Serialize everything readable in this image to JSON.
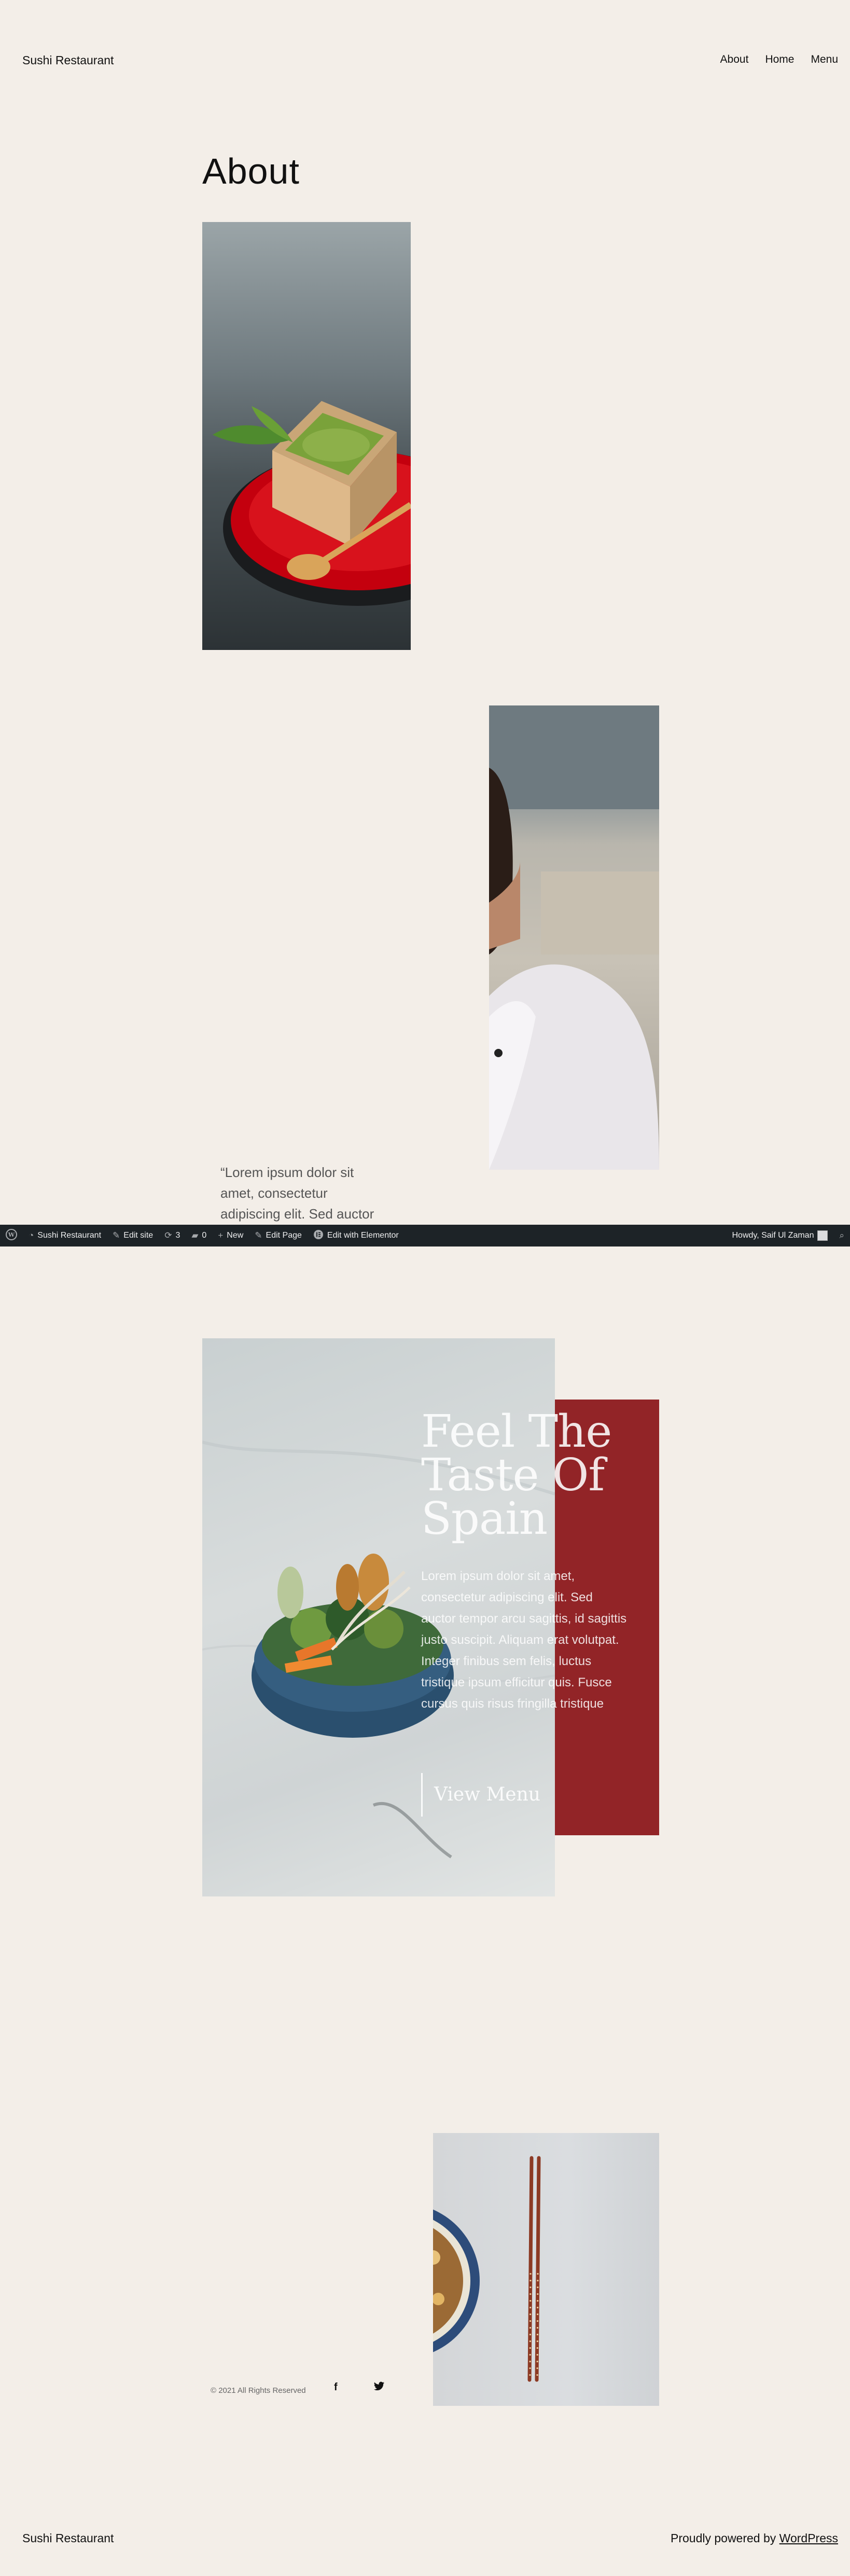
{
  "header": {
    "site_title": "Sushi Restaurant",
    "nav": [
      "About",
      "Home",
      "Menu"
    ]
  },
  "page": {
    "title": "About"
  },
  "quote": "“Lorem ipsum dolor sit amet, consectetur adipiscing elit. Sed auctor sagittis justo suscipit.”",
  "admin_bar": {
    "site": "Sushi Restaurant",
    "edit_site": "Edit site",
    "updates": "3",
    "comments": "0",
    "new": "New",
    "edit_page": "Edit Page",
    "elementor": "Edit with Elementor",
    "howdy": "Howdy, Saif Ul Zaman"
  },
  "promo": {
    "heading": "Feel The Taste Of Spain",
    "body": "Lorem ipsum dolor sit amet, consectetur adipiscing elit. Sed auctor tempor arcu sagittis, id sagittis justo suscipit. Aliquam erat volutpat. Integer finibus sem felis, luctus tristique ipsum efficitur quis. Fusce cursus quis risus fringilla tristique",
    "cta": "View Menu",
    "accent_color": "#922427"
  },
  "social": {
    "copyright": "© 2021 All Rights Reserved",
    "facebook_icon": "facebook-icon",
    "twitter_icon": "twitter-icon"
  },
  "footer": {
    "site_title": "Sushi Restaurant",
    "powered_prefix": "Proudly powered by ",
    "powered_link": "WordPress"
  }
}
